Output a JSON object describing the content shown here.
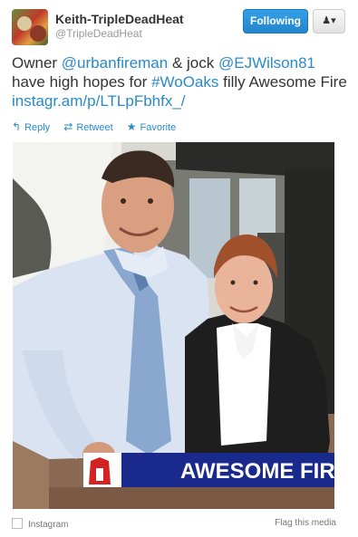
{
  "user": {
    "name": "Keith-TripleDeadHeat",
    "handle": "@TripleDeadHeat"
  },
  "buttons": {
    "follow_label": "Following",
    "user_menu_label": "♟▾"
  },
  "tweet": {
    "parts": {
      "p1": "Owner ",
      "mention1": "@urbanfireman",
      "p2": " & jock ",
      "mention2": "@EJWilson81",
      "p3": " have high hopes for ",
      "hashtag": "#WoOaks",
      "p4": " filly Awesome Fire ",
      "link": "instagr.am/p/LTLpFbhfx_/"
    }
  },
  "actions": {
    "reply": "Reply",
    "retweet": "Retweet",
    "favorite": "Favorite"
  },
  "photo": {
    "banner_text": "AWESOME FIR"
  },
  "footer": {
    "source": "Instagram",
    "flag": "Flag this media"
  },
  "colors": {
    "link": "#2a8ac9",
    "follow_button": "#2485cd"
  }
}
